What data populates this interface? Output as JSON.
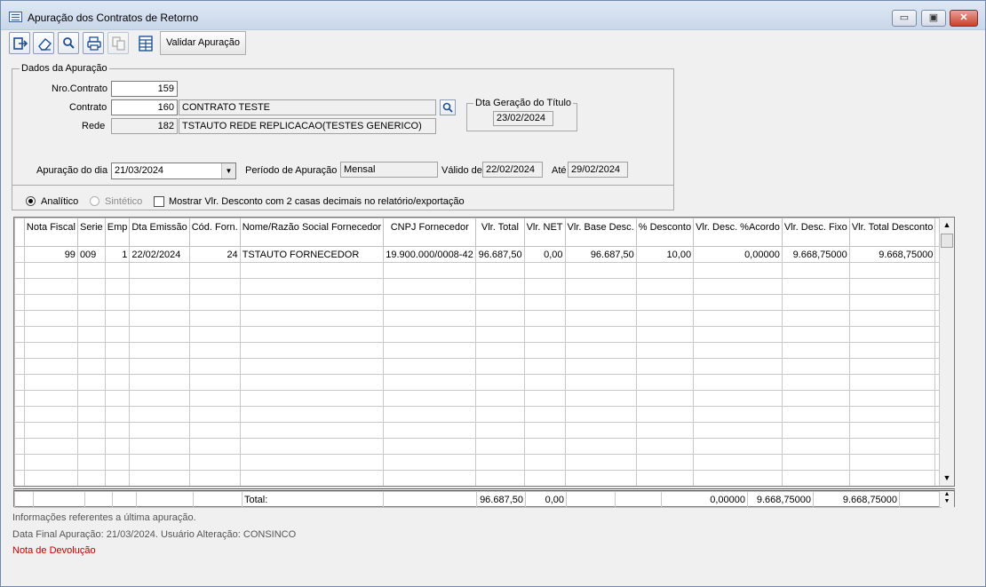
{
  "window": {
    "title": "Apuração dos Contratos de Retorno",
    "controls": {
      "minimize": "▭",
      "maximize": "▣",
      "close": "✕"
    }
  },
  "toolbar": {
    "icons": [
      "exit-icon",
      "eraser-icon",
      "search-icon",
      "print-icon",
      "copy-icon",
      "grid-icon"
    ],
    "validate_label": "Validar Apuração"
  },
  "form": {
    "legend": "Dados da Apuração",
    "nro_contrato_label": "Nro.Contrato",
    "nro_contrato": "159",
    "contrato_label": "Contrato",
    "contrato_code": "160",
    "contrato_name": "CONTRATO TESTE",
    "rede_label": "Rede",
    "rede_code": "182",
    "rede_name": "TSTAUTO REDE REPLICACAO(TESTES GENERICO)",
    "dta_geracao_label": "Dta Geração do Título",
    "dta_geracao": "23/02/2024",
    "apuracao_dia_label": "Apuração do dia",
    "apuracao_dia": "21/03/2024",
    "periodo_label": "Período de Apuração",
    "periodo": "Mensal",
    "valido_label": "Válido de",
    "valido_de": "22/02/2024",
    "ate_label": "Até",
    "ate": "29/02/2024",
    "analitico_label": "Analítico",
    "sintetico_label": "Sintético",
    "mostrar_label": "Mostrar Vlr. Desconto com 2 casas decimais no relatório/exportação"
  },
  "grid": {
    "columns": [
      "Nota Fiscal",
      "Serie",
      "Emp",
      "Dta Emissão",
      "Cód. Forn.",
      "Nome/Razão Social Fornecedor",
      "CNPJ Fornecedor",
      "Vlr. Total",
      "Vlr. NET",
      "Vlr. Base Desc.",
      "% Desconto",
      "Vlr. Desc. %Acordo",
      "Vlr. Desc. Fixo",
      "Vlr. Total Desconto"
    ],
    "rows": [
      [
        "99",
        "009",
        "1",
        "22/02/2024",
        "24",
        "TSTAUTO FORNECEDOR",
        "19.900.000/0008-42",
        "96.687,50",
        "0,00",
        "96.687,50",
        "10,00",
        "0,00000",
        "9.668,75000",
        "9.668,75000"
      ]
    ],
    "totals": {
      "label": "Total:",
      "vlr_total": "96.687,50",
      "vlr_net": "0,00",
      "desc_acordo": "0,00000",
      "desc_fixo": "9.668,75000",
      "total_desconto": "9.668,75000"
    }
  },
  "footer": {
    "info1": "Informações referentes a última apuração.",
    "info2": "Data Final Apuração: 21/03/2024. Usuário Alteração: CONSINCO",
    "nota": "Nota de Devolução"
  }
}
